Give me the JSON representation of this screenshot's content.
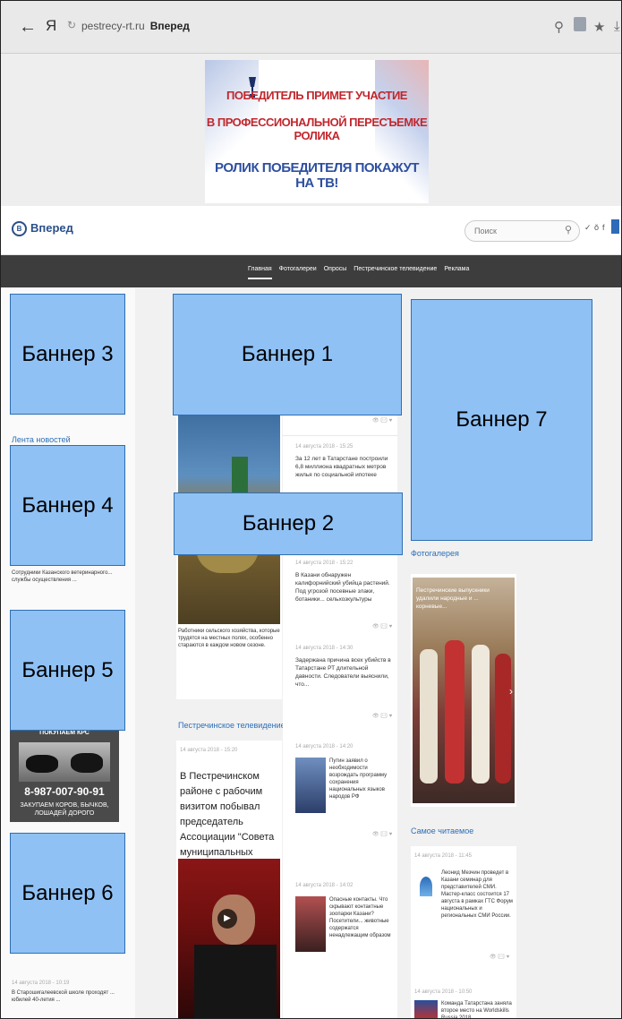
{
  "browser": {
    "back": "←",
    "yandex_logo": "Я",
    "url": "pestrecy-rt.ru",
    "page_title": "Вперед"
  },
  "ad": {
    "line1": "ПОБЕДИТЕЛЬ ПРИМЕТ УЧАСТИЕ",
    "line2": "В ПРОФЕССИОНАЛЬНОЙ ПЕРЕСЪЕМКЕ РОЛИКА",
    "line3": "РОЛИК ПОБЕДИТЕЛЯ ПОКАЖУТ НА ТВ!"
  },
  "header": {
    "logo": "Вперед",
    "search_placeholder": "Поиск"
  },
  "nav": [
    "Главная",
    "Фотогалереи",
    "Опросы",
    "Пестречинское телевидение",
    "Реклама"
  ],
  "banners": {
    "b1": "Баннер 1",
    "b2": "Баннер 2",
    "b3": "Баннер 3",
    "b4": "Баннер 4",
    "b5": "Баннер 5",
    "b6": "Баннер 6",
    "b7": "Баннер 7"
  },
  "sections": {
    "news_feed": "Лента новостей",
    "tv": "Пестречинское телевидение",
    "photo_gallery": "Фотогалерея",
    "most_read": "Самое читаемое"
  },
  "left_col": {
    "news1": "Сотрудники Казанского ветеринарного... службы осуществления ...",
    "ad_phone": "8-987-007-90-91",
    "ad_text": "ЗАКУПАЕМ КОРОВ, БЫЧКОВ, ЛОШАДЕЙ ДОРОГО",
    "ad_top": "ПОКУПАЕМ КРС",
    "bottom_date": "14 августа 2018 - 10:19",
    "bottom_text": "В Старошигалеевской школе проходят ... юбилей 40-летия ..."
  },
  "mid_col": {
    "lead_text": "Работники сельского хозяйства, которые трудятся на местных полях, особенно стараются в каждом новом сезоне.",
    "tv_date": "14 августа 2018 - 15:20",
    "tv_title": "В Пестречинском районе с рабочим визитом побывал председатель Ассоциации \"Совета муниципальных образований РТ\""
  },
  "news_col": [
    {
      "date": "14 августа 2018 - 15:25",
      "text": "За 12 лет в Татарстане построили 6,8 миллиона квадратных метров жилья по социальной ипотеке"
    },
    {
      "date": "14 августа 2018 - 15:22",
      "text": "В Казани обнаружен калифорнийский убийца растений. Под угрозой посевные злаки, ботаники... сельхозкультуры"
    },
    {
      "date": "14 августа 2018 - 14:30",
      "text": "Задержана причина всех убийств в Татарстане РТ длительной давности. Следователи выяснили, что..."
    },
    {
      "date": "14 августа 2018 - 14:20",
      "text": "Путин заявил о необходимости возрождать программу сохранения национальных языков народов РФ"
    },
    {
      "date": "14 августа 2018 - 14:02",
      "text": "Опасные контакты. Что скрывают контактные зоопарки Казани? Посетители... животные содержатся ненадлежащим образом"
    }
  ],
  "right_col": {
    "gallery_caption": "Пестречинские выпускники удалили народные и ... корневые...",
    "most_read_date": "14 августа 2018 - 11:45",
    "most_read_text": "Леонид Мезчин проведет в Казани семинар для представителей СМИ. Мастер-класс состоится 17 августа в рамках ГТС Форум национальных и региональных СМИ России.",
    "second_date": "14 августа 2018 - 10:50",
    "second_text": "Команда Татарстана заняла второе место на Worldskills Russia 2018"
  }
}
